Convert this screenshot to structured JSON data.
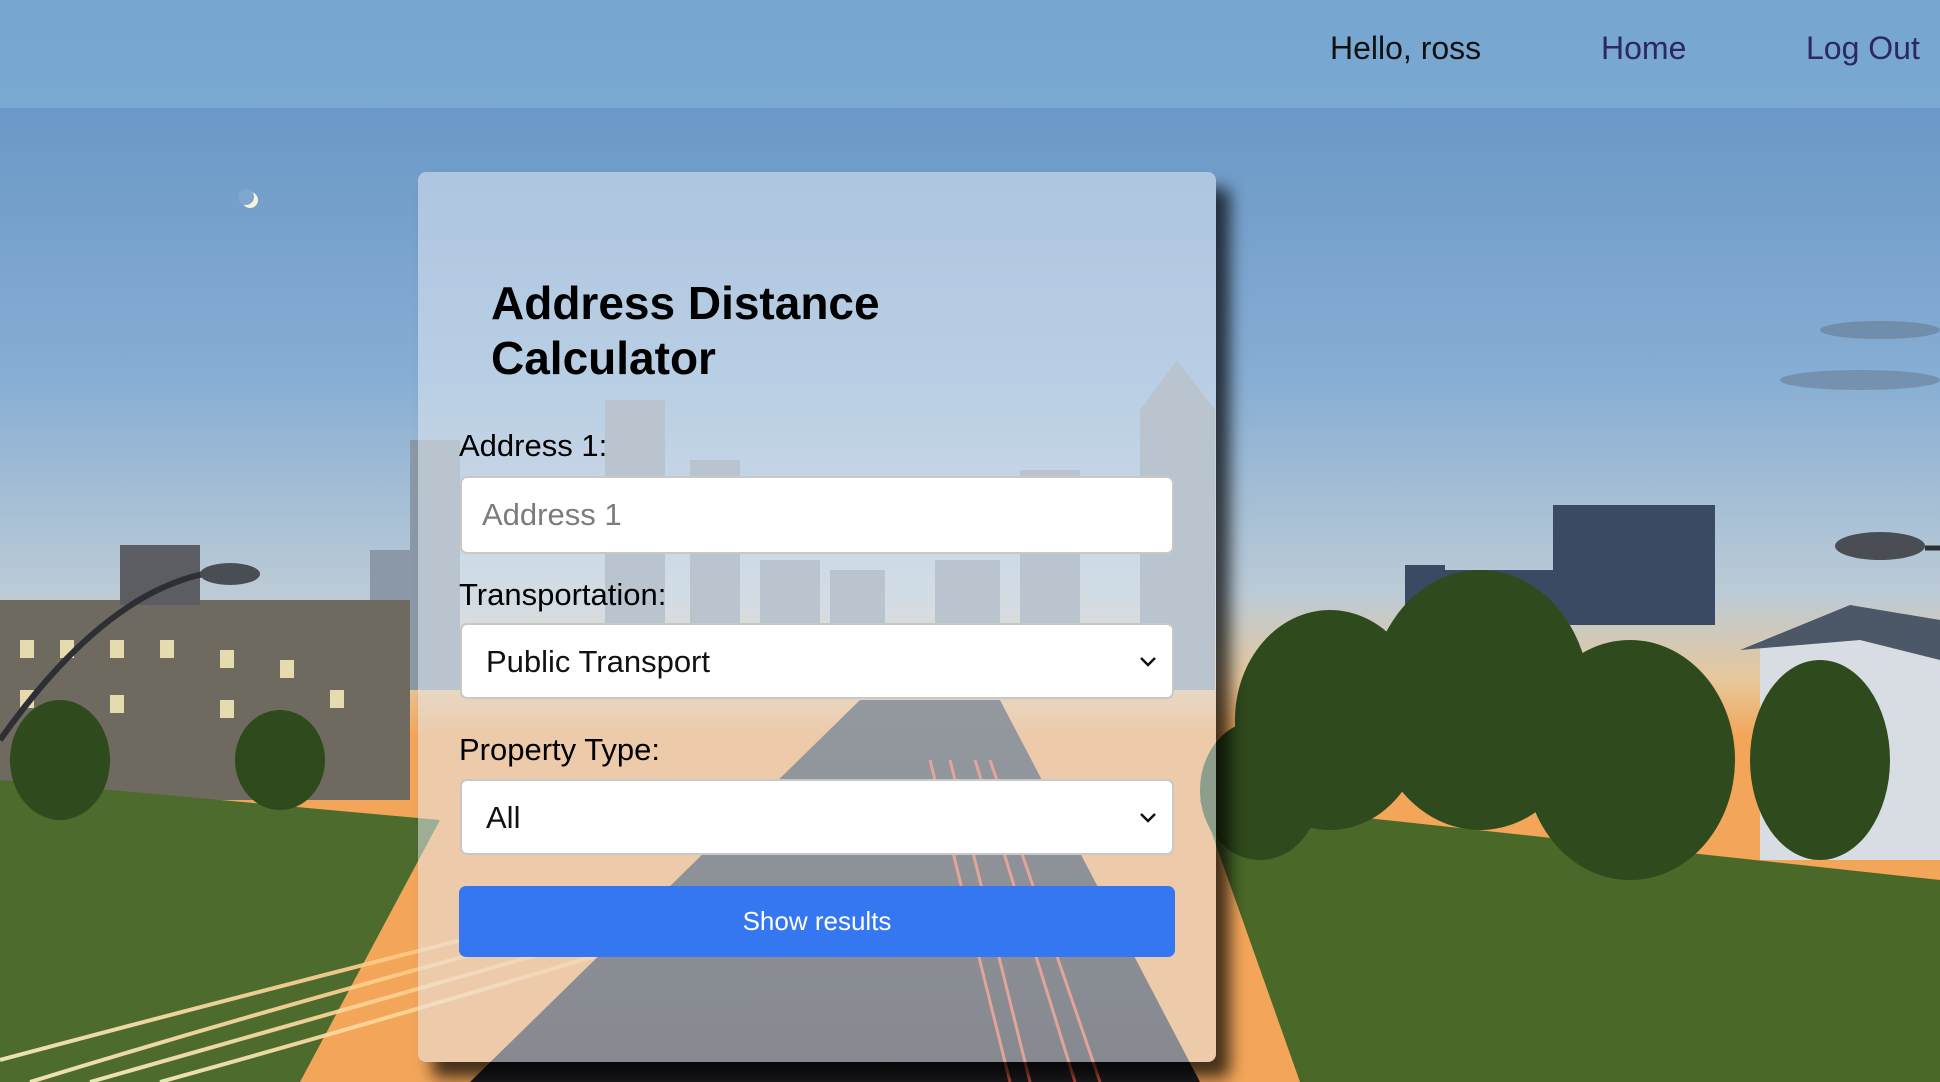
{
  "nav": {
    "greeting": "Hello, ross",
    "home_label": "Home",
    "logout_label": "Log Out"
  },
  "form": {
    "title": "Address Distance Calculator",
    "address_label": "Address 1:",
    "address_placeholder": "Address 1",
    "address_value": "",
    "transportation_label": "Transportation:",
    "transportation_selected": "Public Transport",
    "property_label": "Property Type:",
    "property_selected": "All",
    "submit_label": "Show results"
  },
  "colors": {
    "topbar": "#80aed6",
    "button": "#3577f1",
    "nav_link": "#2c2766"
  }
}
